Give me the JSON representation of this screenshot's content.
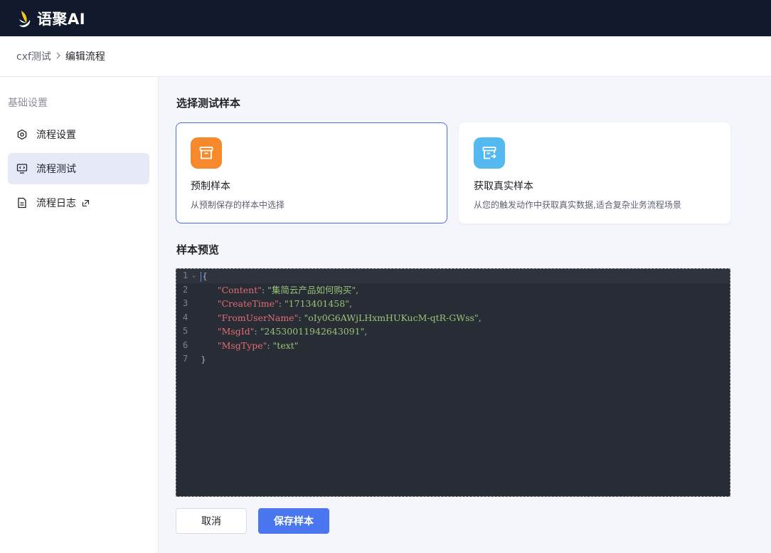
{
  "app": {
    "brand_name": "语聚AI",
    "logo_icon": "feather-logo",
    "colors": {
      "topbar": "#111a2c",
      "accent": "#4a77f0",
      "selected_border": "#4a6ee0",
      "orange_icon": "#f5892b",
      "blue_icon": "#54b9f1"
    }
  },
  "breadcrumb": {
    "parent": "cxf测试",
    "separator": ">",
    "current": "编辑流程"
  },
  "sidebar": {
    "section_title": "基础设置",
    "items": [
      {
        "label": "流程设置",
        "icon": "settings-hexagon-icon",
        "active": false
      },
      {
        "label": "流程测试",
        "icon": "monitor-code-icon",
        "active": true
      },
      {
        "label": "流程日志",
        "icon": "document-icon",
        "active": false,
        "external_icon": "external-link-icon"
      }
    ]
  },
  "main": {
    "select_title": "选择测试样本",
    "cards": [
      {
        "title": "预制样本",
        "desc": "从预制保存的样本中选择",
        "icon": "archive-box-icon",
        "selected": true
      },
      {
        "title": "获取真实样本",
        "desc": "从您的触发动作中获取真实数据,适合复杂业务流程场景",
        "icon": "archive-export-icon",
        "selected": false
      }
    ],
    "preview_title": "样本预览",
    "code_lines": [
      {
        "num": "1",
        "open": "{"
      },
      {
        "num": "2",
        "key": "\"Content\"",
        "value": "\"集简云产品如何购买\"",
        "trail": ","
      },
      {
        "num": "3",
        "key": "\"CreateTime\"",
        "value": "\"1713401458\"",
        "trail": ","
      },
      {
        "num": "4",
        "key": "\"FromUserName\"",
        "value": "\"oIy0G6AWjLHxmHUKucM-qtR-GWss\"",
        "trail": ","
      },
      {
        "num": "5",
        "key": "\"MsgId\"",
        "value": "\"24530011942643091\"",
        "trail": ","
      },
      {
        "num": "6",
        "key": "\"MsgType\"",
        "value": "\"text\"",
        "trail": ""
      },
      {
        "num": "7",
        "close": "}"
      }
    ]
  },
  "actions": {
    "cancel_label": "取消",
    "save_label": "保存样本"
  }
}
